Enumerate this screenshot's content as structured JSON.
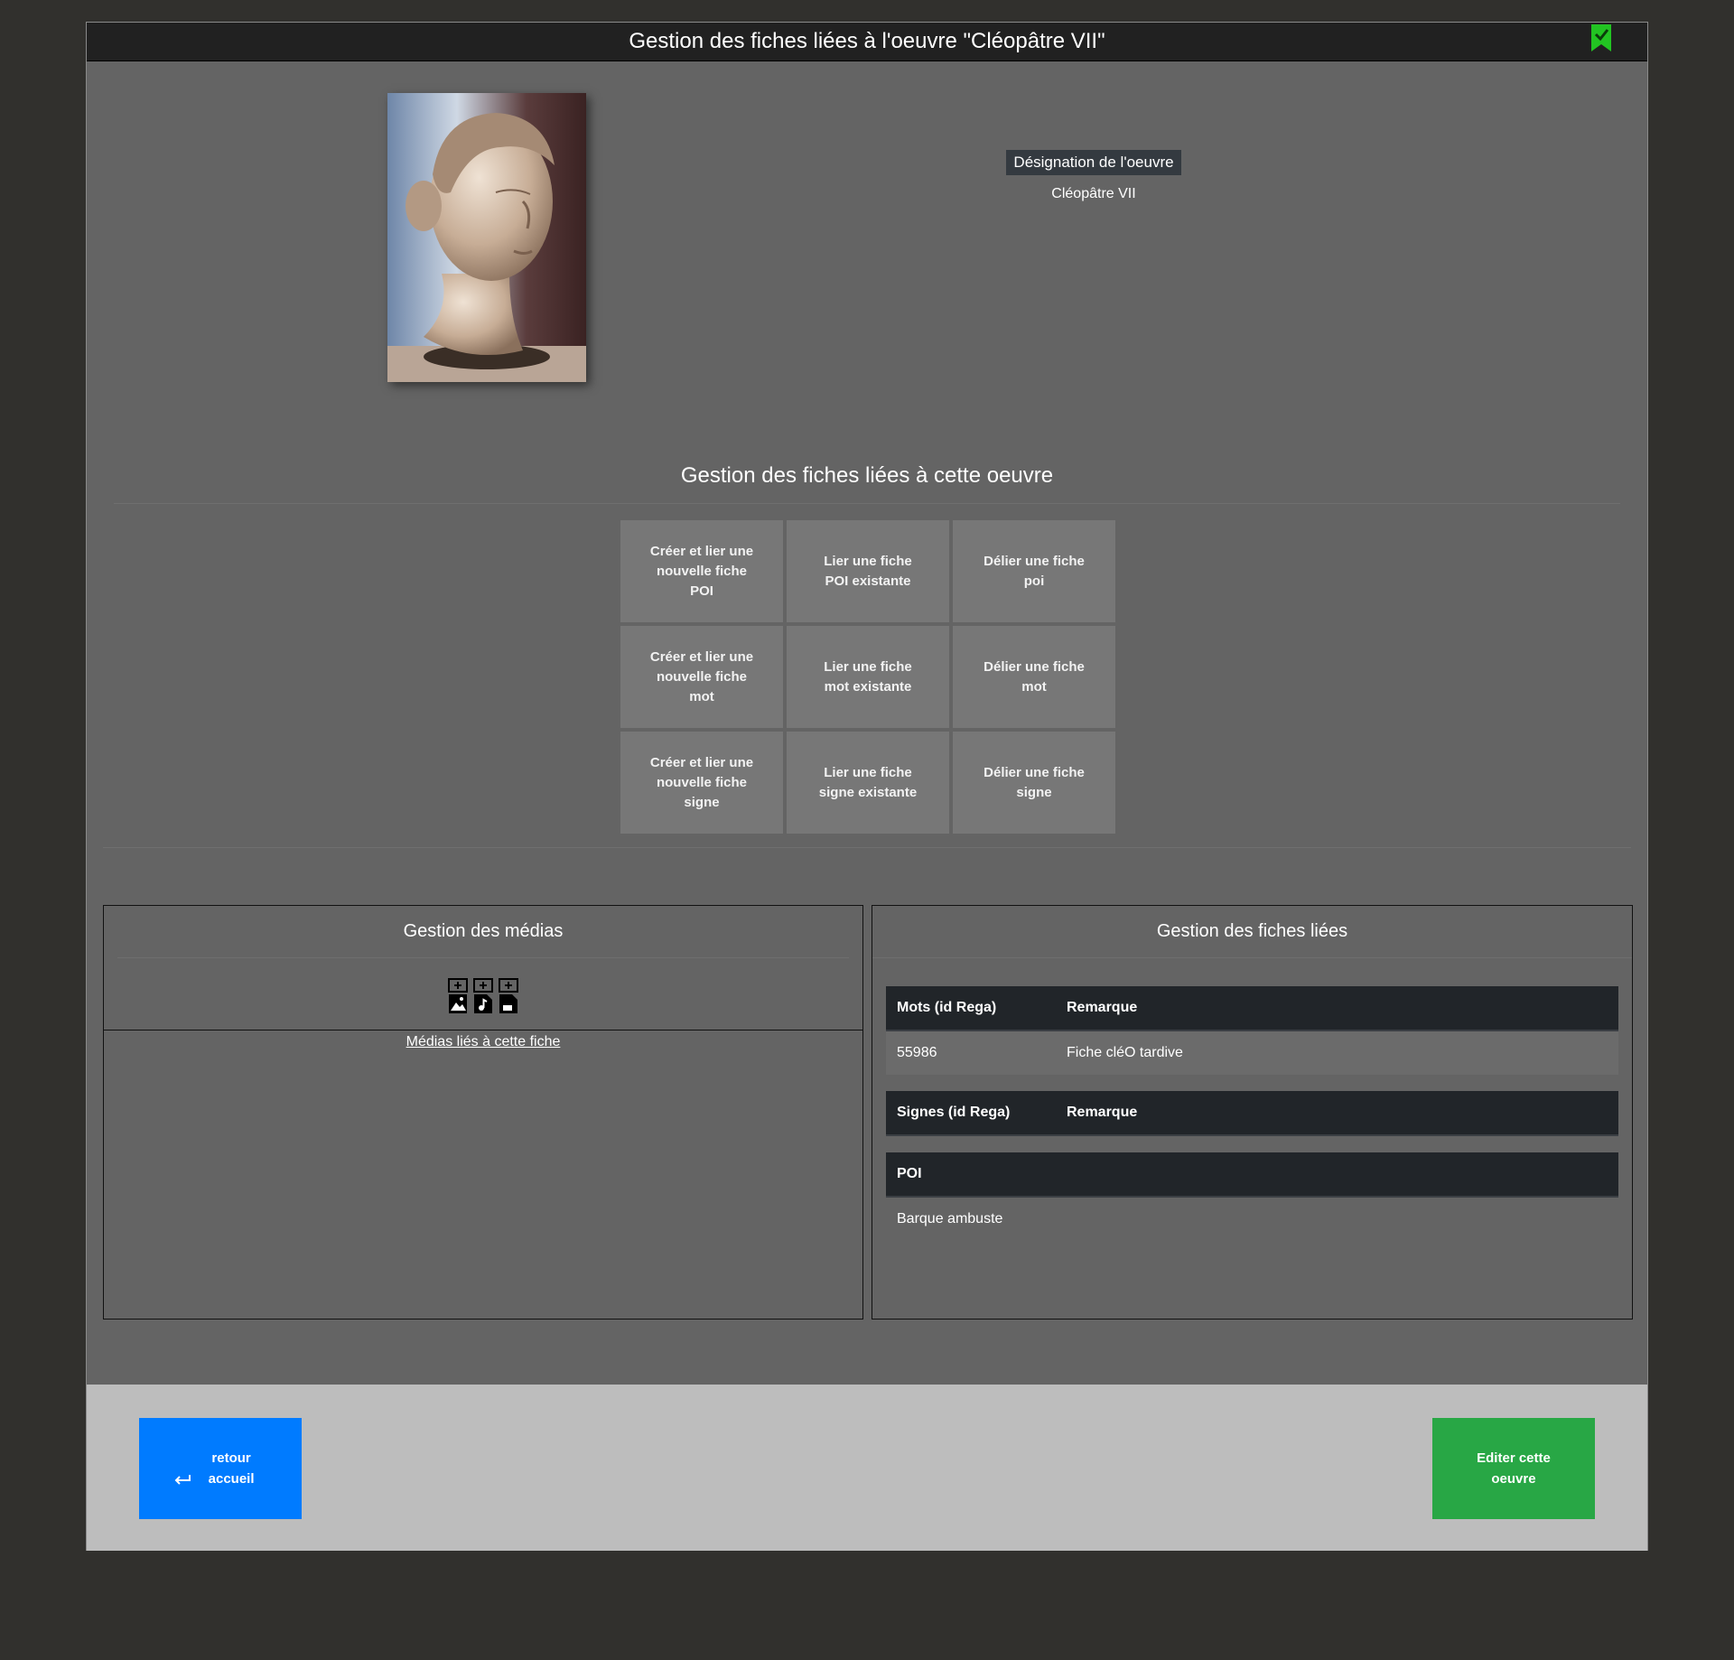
{
  "header": {
    "title": "Gestion des fiches liées à l'oeuvre \"Cléopâtre VII\"",
    "bookmark_icon": "bookmark-check-icon",
    "bookmark_color": "#22c422"
  },
  "artwork": {
    "designation_label": "Désignation de l'oeuvre",
    "designation_value": "Cléopâtre VII"
  },
  "fiches_section": {
    "title": "Gestion des fiches liées à cette oeuvre",
    "tiles": [
      "Créer et lier une nouvelle fiche POI",
      "Lier une fiche POI existante",
      "Délier une fiche poi",
      "Créer et lier une nouvelle fiche mot",
      "Lier une fiche mot existante",
      "Délier une fiche mot",
      "Créer et lier une nouvelle fiche signe",
      "Lier une fiche signe existante",
      "Délier une fiche signe"
    ]
  },
  "media_panel": {
    "title": "Gestion des médias",
    "icons": [
      "add-image-icon",
      "add-audio-icon",
      "add-document-icon"
    ],
    "link": "Médias liés à cette fiche"
  },
  "linked_panel": {
    "title": "Gestion des fiches liées",
    "mots": {
      "col1": "Mots (id Rega)",
      "col2": "Remarque",
      "rows": [
        {
          "id": "55986",
          "remarque": "Fiche cléO tardive"
        }
      ]
    },
    "signes": {
      "col1": "Signes (id Rega)",
      "col2": "Remarque"
    },
    "poi": {
      "col1": "POI",
      "rows": [
        "Barque ambuste"
      ]
    }
  },
  "footer": {
    "back_icon": "return-arrow-icon",
    "back_label": "retour accueil",
    "edit_label": "Editer cette oeuvre",
    "back_color": "#007bff",
    "edit_color": "#28a745"
  }
}
